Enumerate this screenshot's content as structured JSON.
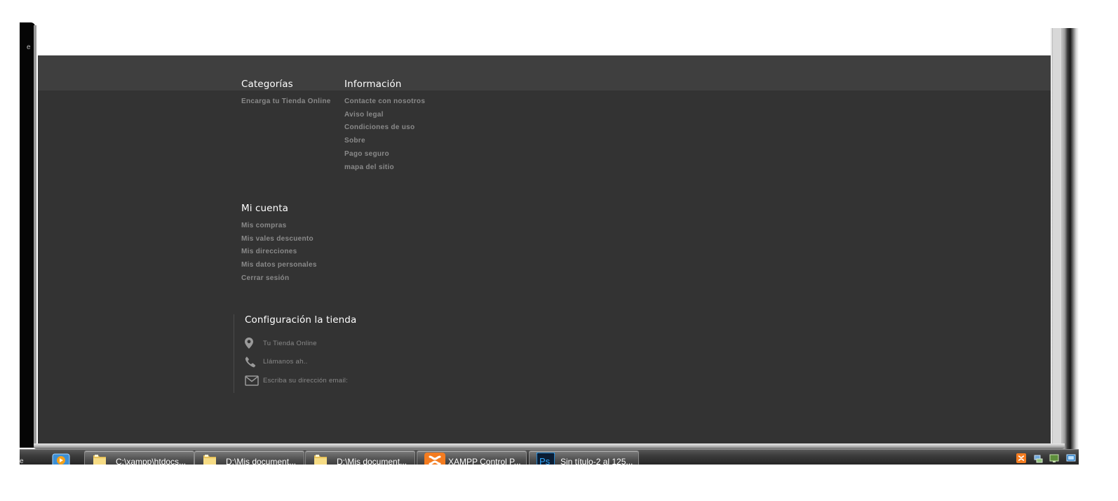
{
  "window": {
    "left_edge_text": "e"
  },
  "footer": {
    "categorias": {
      "title": "Categorías",
      "items": [
        "Encarga tu Tienda Online"
      ]
    },
    "informacion": {
      "title": "Información",
      "items": [
        "Contacte con nosotros",
        "Aviso legal",
        "Condiciones de uso",
        "Sobre",
        "Pago seguro",
        "mapa del sitio"
      ]
    },
    "mi_cuenta": {
      "title": "Mi cuenta",
      "items": [
        "Mis compras",
        "Mis vales descuento",
        "Mis direcciones",
        "Mis datos personales",
        "Cerrar sesión"
      ]
    },
    "configuracion": {
      "title": "Configuración la tienda",
      "address": "Tu Tienda Online",
      "phone": "Llámanos ah..",
      "email": "Escriba su dirección email:"
    }
  },
  "taskbar": {
    "start_label": "e",
    "items": [
      {
        "label": "C:\\xampp\\htdocs...",
        "icon": "folder-icon"
      },
      {
        "label": "D:\\Mis document...",
        "icon": "folder-icon"
      },
      {
        "label": "D:\\Mis document...",
        "icon": "folder-icon"
      },
      {
        "label": "XAMPP Control P...",
        "icon": "xampp-icon"
      },
      {
        "label": "Sin título-2 al 125...",
        "icon": "photoshop-icon"
      }
    ],
    "tray_icons": [
      "xampp-tray-icon",
      "network-tray-icon",
      "display-tray-icon",
      "monitor-tray-icon"
    ]
  },
  "colors": {
    "footer_bg": "#333333",
    "footer_band": "#3f3f3f",
    "heading": "#ffffff",
    "link": "#8a8a8a",
    "xampp_orange": "#f47c20",
    "photoshop_blue": "#31a8ff"
  }
}
